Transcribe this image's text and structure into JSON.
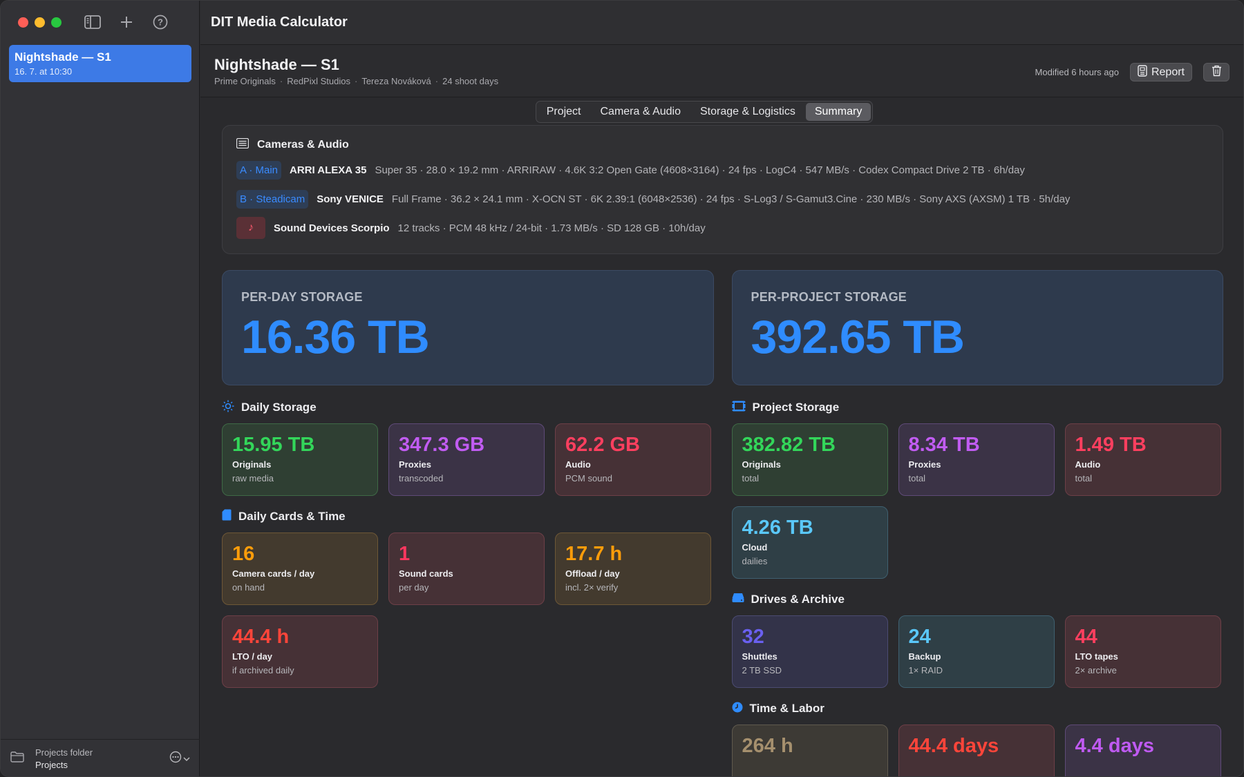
{
  "app": {
    "title": "DIT Media Calculator"
  },
  "sidebar": {
    "items": [
      {
        "title": "Nightshade — S1",
        "subtitle": "16. 7. at 10:30"
      }
    ],
    "footer": {
      "line1": "Projects folder",
      "line2": "Projects"
    }
  },
  "header": {
    "title": "Nightshade — S1",
    "meta": [
      "Prime Originals",
      "RedPixl Studios",
      "Tereza Nováková",
      "24 shoot days"
    ],
    "separator": "·",
    "modified": "Modified 6 hours ago",
    "report_label": "Report"
  },
  "tabs": [
    {
      "label": "Project",
      "active": false
    },
    {
      "label": "Camera & Audio",
      "active": false
    },
    {
      "label": "Storage & Logistics",
      "active": false
    },
    {
      "label": "Summary",
      "active": true
    }
  ],
  "cameras_section": {
    "title": "Cameras & Audio",
    "rows": [
      {
        "badge": "A · Main",
        "name": "ARRI ALEXA 35",
        "specs": "Super 35 · 28.0 × 19.2 mm · ARRIRAW · 4.6K 3:2 Open Gate (4608×3164) · 24 fps · LogC4 · 547 MB/s · Codex Compact Drive 2 TB · 6h/day"
      },
      {
        "badge": "B · Steadicam",
        "name": "Sony VENICE",
        "specs": "Full Frame · 36.2 × 24.1 mm · X-OCN ST · 6K 2.39:1 (6048×2536) · 24 fps · S-Log3 / S-Gamut3.Cine · 230 MB/s · Sony AXS (AXSM) 1 TB · 5h/day"
      },
      {
        "badge": "♪",
        "name": "Sound Devices Scorpio",
        "specs": "12 tracks · PCM 48 kHz / 24-bit · 1.73 MB/s · SD 128 GB · 10h/day"
      }
    ]
  },
  "totals": {
    "per_day": {
      "label": "PER-DAY STORAGE",
      "value": "16.36 TB"
    },
    "per_project": {
      "label": "PER-PROJECT STORAGE",
      "value": "392.65 TB"
    }
  },
  "daily_storage": {
    "title": "Daily Storage",
    "cards": [
      {
        "value": "15.95 TB",
        "label": "Originals",
        "sub": "raw media"
      },
      {
        "value": "347.3 GB",
        "label": "Proxies",
        "sub": "transcoded"
      },
      {
        "value": "62.2 GB",
        "label": "Audio",
        "sub": "PCM sound"
      }
    ]
  },
  "daily_cards": {
    "title": "Daily Cards & Time",
    "cards": [
      {
        "value": "16",
        "label": "Camera cards / day",
        "sub": "on hand"
      },
      {
        "value": "1",
        "label": "Sound cards",
        "sub": "per day"
      },
      {
        "value": "17.7 h",
        "label": "Offload / day",
        "sub": "incl. 2× verify"
      },
      {
        "value": "44.4 h",
        "label": "LTO / day",
        "sub": "if archived daily"
      }
    ]
  },
  "project_storage": {
    "title": "Project Storage",
    "cards": [
      {
        "value": "382.82 TB",
        "label": "Originals",
        "sub": "total"
      },
      {
        "value": "8.34 TB",
        "label": "Proxies",
        "sub": "total"
      },
      {
        "value": "1.49 TB",
        "label": "Audio",
        "sub": "total"
      },
      {
        "value": "4.26 TB",
        "label": "Cloud",
        "sub": "dailies"
      }
    ]
  },
  "drives_archive": {
    "title": "Drives & Archive",
    "cards": [
      {
        "value": "32",
        "label": "Shuttles",
        "sub": "2 TB SSD"
      },
      {
        "value": "24",
        "label": "Backup",
        "sub": "1× RAID"
      },
      {
        "value": "44",
        "label": "LTO tapes",
        "sub": "2× archive"
      }
    ]
  },
  "time_labor": {
    "title": "Time & Labor",
    "cards": [
      {
        "value": "264 h"
      },
      {
        "value": "44.4 days"
      },
      {
        "value": "4.4 days"
      }
    ]
  },
  "colors": {
    "accent": "#3d7ae6",
    "big_value": "#2f8cff",
    "green": "#33d65a",
    "purple": "#c15cf2",
    "red": "#ff3f5f",
    "orange": "#ff9d0a",
    "teal": "#5ac8fa",
    "indigo": "#6a60f0"
  },
  "icons": {
    "sidebar_toggle": "sidebar-toggle-icon",
    "add": "plus-icon",
    "help": "question-circle-icon",
    "report": "document-icon",
    "trash": "trash-icon",
    "cameras": "list-icon",
    "daily_storage": "sun-icon",
    "daily_cards": "sd-card-icon",
    "project_storage": "film-icon",
    "drives": "drive-icon",
    "time": "clock-icon",
    "folder": "folder-icon",
    "more": "ellipsis-circle-icon"
  }
}
